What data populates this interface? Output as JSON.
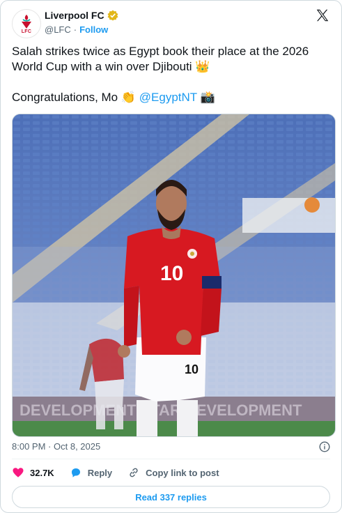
{
  "author": {
    "name": "Liverpool FC",
    "handle": "@LFC",
    "separator": "·",
    "follow_label": "Follow",
    "verified_icon": "gold-verified-badge",
    "avatar_icon": "lfc-crest",
    "avatar_text": "LFC"
  },
  "platform_icon": "x-logo",
  "tweet": {
    "line1": "Salah strikes twice as Egypt book their place at the 2026 World Cup with a win over Djibouti",
    "line1_emoji": "👑",
    "line2_prefix": "Congratulations, Mo",
    "clap_emoji": "👏",
    "mention": "@EgyptNT",
    "camera_emoji": "📸"
  },
  "media": {
    "shirt_number": "10",
    "shorts_number": "10",
    "board_text": "DEVELOPMENT   STAR DEVELOPMENT"
  },
  "meta": {
    "time": "8:00 PM",
    "separator": "·",
    "date": "Oct 8, 2025",
    "info_icon": "info-icon"
  },
  "actions": {
    "likes": "32.7K",
    "reply": "Reply",
    "copy_link": "Copy link to post"
  },
  "read_replies": "Read 337 replies",
  "colors": {
    "accent": "#1d9bf0",
    "heart": "#f91880",
    "muted": "#536471",
    "text": "#0f1419",
    "lfc_red": "#c8102e"
  }
}
